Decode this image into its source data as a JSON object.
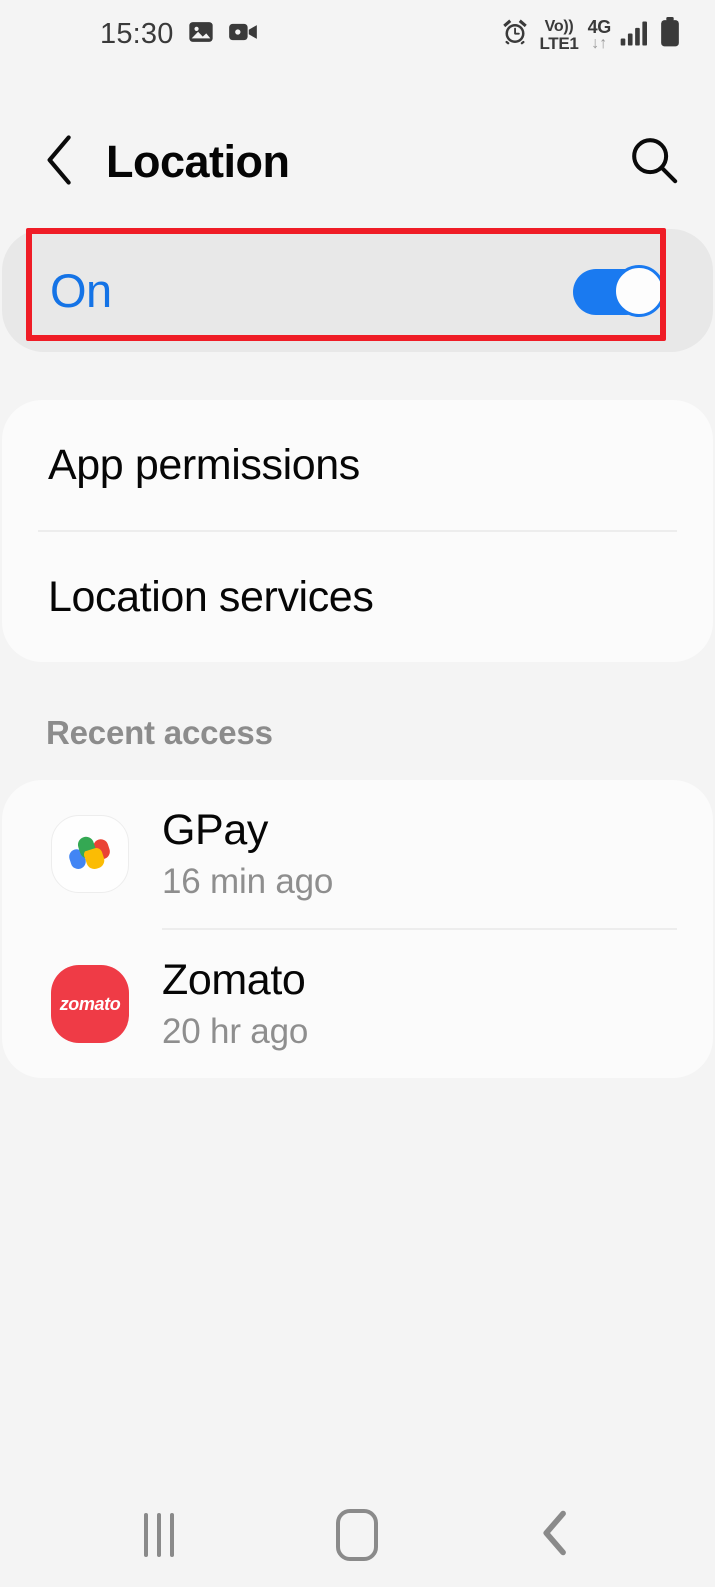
{
  "status_bar": {
    "time": "15:30",
    "left_icons": [
      "image-icon",
      "video-camera-icon"
    ],
    "right_icons": [
      "alarm-icon",
      "volte-icon",
      "network-4g-icon",
      "signal-bars-icon",
      "battery-icon"
    ],
    "volte_top": "Vo))",
    "volte_bottom": "LTE1",
    "network_type": "4G",
    "data_arrows": "↓↑"
  },
  "header": {
    "back_icon": "chevron-left-icon",
    "title": "Location",
    "search_icon": "search-icon"
  },
  "master_toggle": {
    "label": "On",
    "state": "on",
    "highlighted": true,
    "highlight_color": "#ef1c26",
    "accent_color": "#1473e6"
  },
  "menu": {
    "items": [
      {
        "label": "App permissions"
      },
      {
        "label": "Location services"
      }
    ]
  },
  "recent_access": {
    "section_title": "Recent access",
    "apps": [
      {
        "name": "GPay",
        "time": "16 min ago",
        "icon": "gpay-icon"
      },
      {
        "name": "Zomato",
        "time": "20 hr ago",
        "icon": "zomato-icon",
        "icon_text": "zomato"
      }
    ]
  },
  "nav_bar": {
    "recents_label": "recents-icon",
    "home_label": "home-icon",
    "back_label": "back-icon"
  }
}
